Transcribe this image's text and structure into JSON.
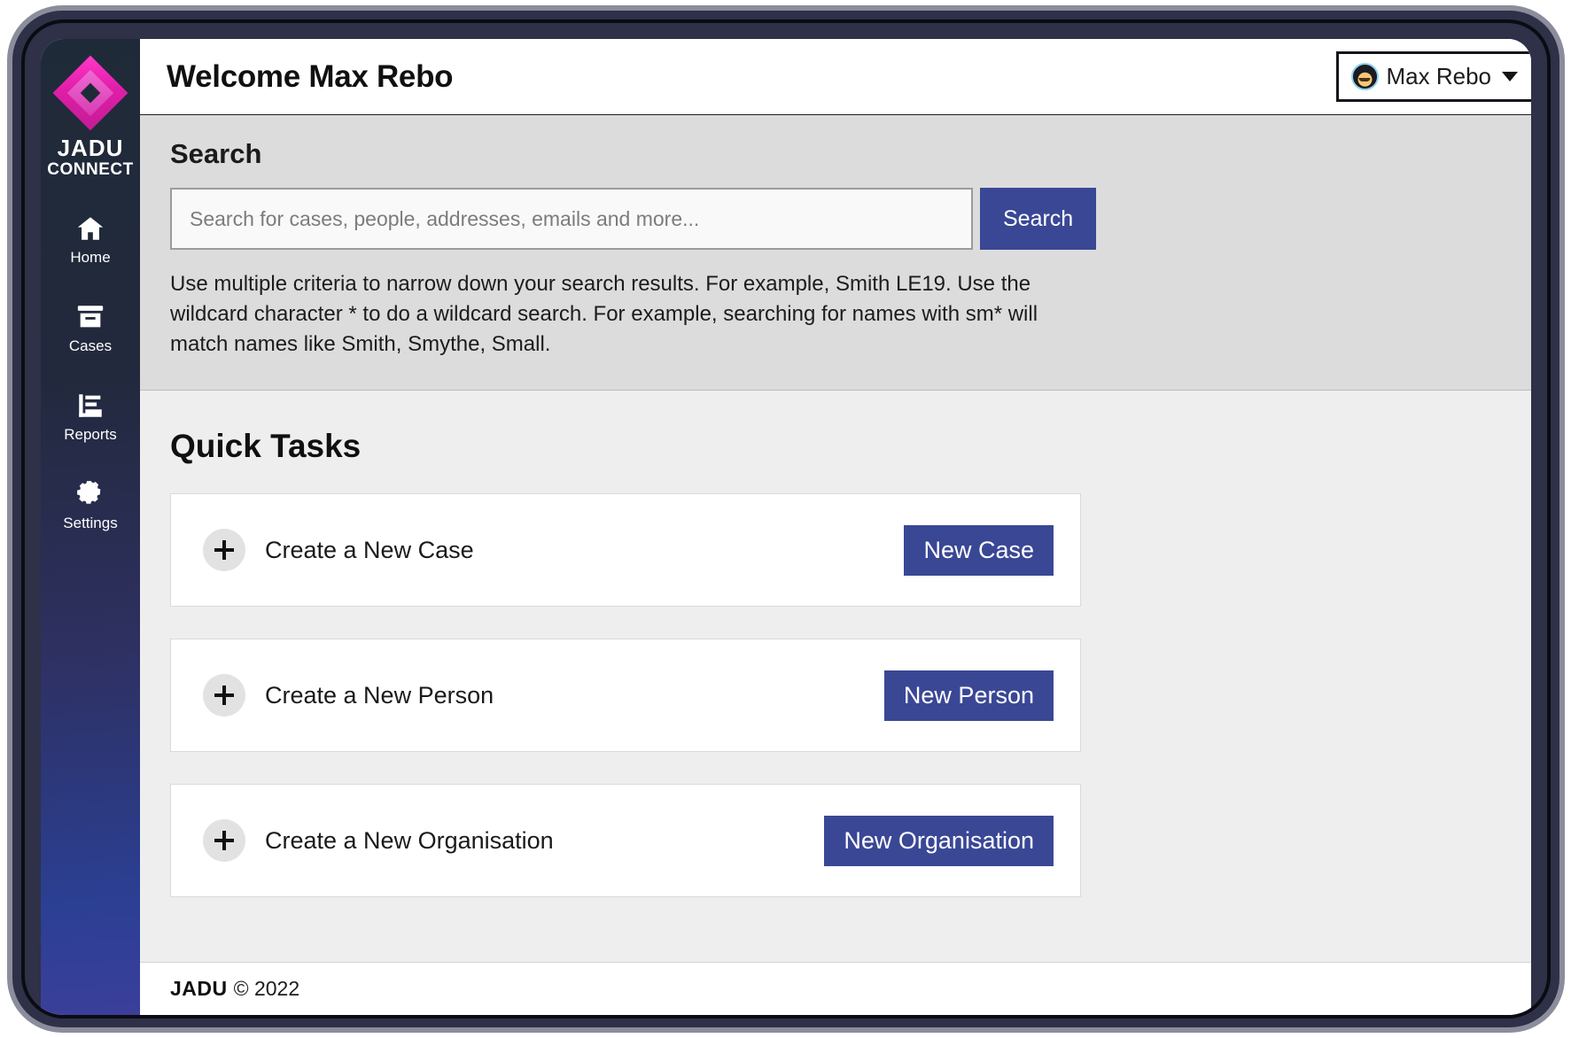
{
  "brand": {
    "logo_name": "JADU",
    "logo_sub": "CONNECT",
    "logo_icon": "diamond-logo-icon"
  },
  "sidebar": {
    "items": [
      {
        "label": "Home",
        "icon": "home-icon"
      },
      {
        "label": "Cases",
        "icon": "archive-box-icon"
      },
      {
        "label": "Reports",
        "icon": "bar-chart-icon"
      },
      {
        "label": "Settings",
        "icon": "gear-icon"
      }
    ]
  },
  "header": {
    "title": "Welcome Max Rebo",
    "user_menu": {
      "name": "Max Rebo",
      "avatar_icon": "user-avatar-icon",
      "caret_icon": "chevron-down-icon"
    }
  },
  "search": {
    "heading": "Search",
    "placeholder": "Search for cases, people, addresses, emails and more...",
    "value": "",
    "button_label": "Search",
    "help_text": "Use multiple criteria to narrow down your search results. For example, Smith LE19. Use the wildcard character * to do a wildcard search. For example, searching for names with sm* will match names like Smith, Smythe, Small."
  },
  "quick_tasks": {
    "heading": "Quick Tasks",
    "items": [
      {
        "label": "Create a New Case",
        "button_label": "New Case",
        "icon": "plus-icon"
      },
      {
        "label": "Create a New Person",
        "button_label": "New Person",
        "icon": "plus-icon"
      },
      {
        "label": "Create a New Organisation",
        "button_label": "New Organisation",
        "icon": "plus-icon"
      }
    ]
  },
  "footer": {
    "logo": "JADU",
    "copyright": "© 2022"
  },
  "colors": {
    "accent_blue": "#3a4795",
    "brand_magenta": "#e01ea8",
    "sidebar_top": "#1f2a38",
    "sidebar_bottom": "#3b3f9a"
  }
}
